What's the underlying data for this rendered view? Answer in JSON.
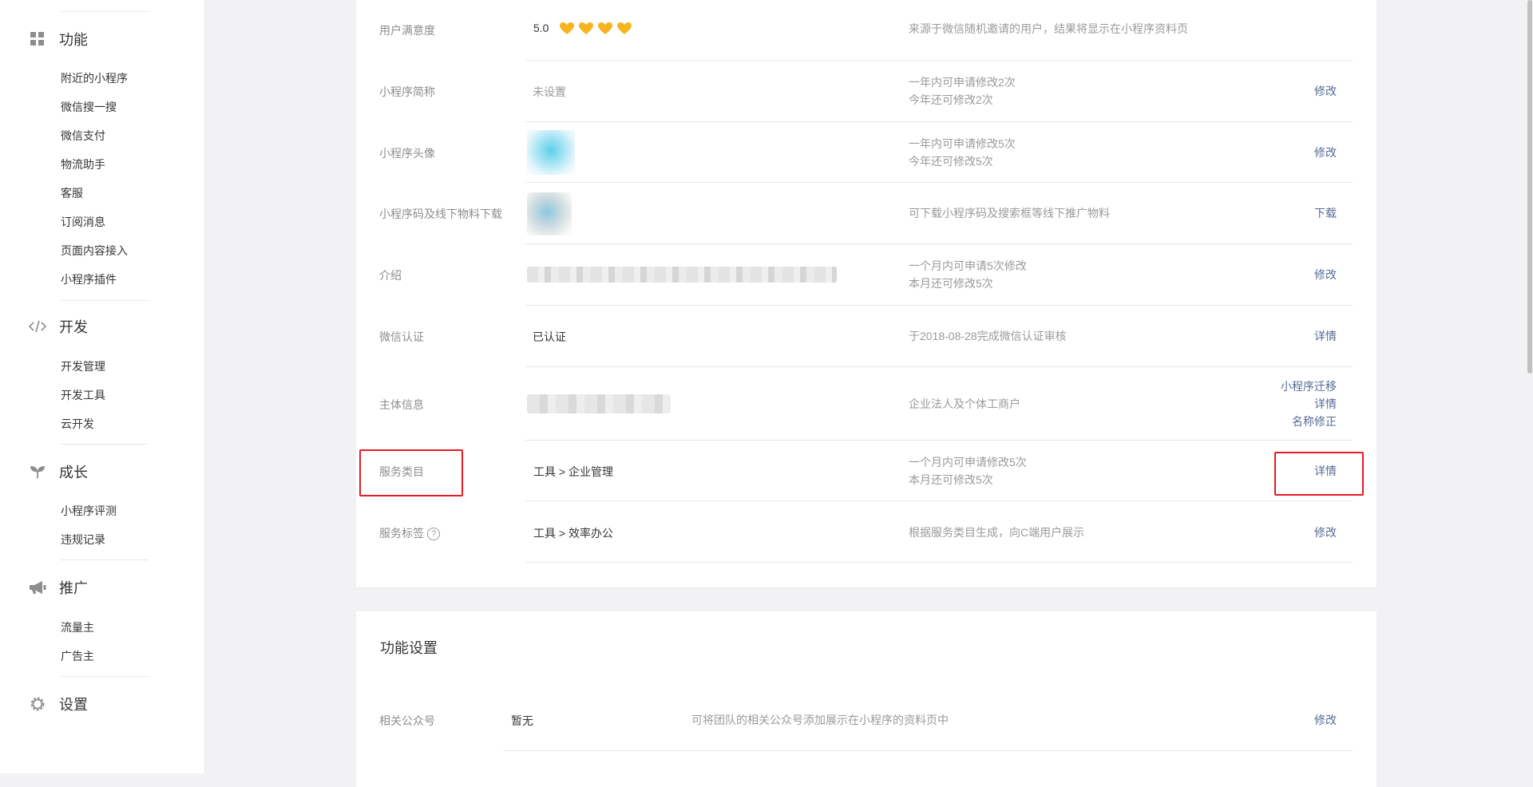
{
  "sidebar": {
    "sections": [
      {
        "title": "功能",
        "icon": "grid-icon",
        "items": [
          "附近的小程序",
          "微信搜一搜",
          "微信支付",
          "物流助手",
          "客服",
          "订阅消息",
          "页面内容接入",
          "小程序插件"
        ]
      },
      {
        "title": "开发",
        "icon": "code-icon",
        "items": [
          "开发管理",
          "开发工具",
          "云开发"
        ]
      },
      {
        "title": "成长",
        "icon": "sprout-icon",
        "items": [
          "小程序评测",
          "违规记录"
        ]
      },
      {
        "title": "推广",
        "icon": "megaphone-icon",
        "items": [
          "流量主",
          "广告主"
        ]
      },
      {
        "title": "设置",
        "icon": "gear-icon",
        "items": []
      }
    ]
  },
  "info": {
    "rows": [
      {
        "label": "用户满意度",
        "value": "5.0",
        "rating": 5.0,
        "hearts": 4,
        "note": "来源于微信随机邀请的用户，结果将显示在小程序资料页",
        "actions": []
      },
      {
        "label": "小程序简称",
        "value": "未设置",
        "note_lines": [
          "一年内可申请修改2次",
          "今年还可修改2次"
        ],
        "actions": [
          "修改"
        ]
      },
      {
        "label": "小程序头像",
        "note_lines": [
          "一年内可申请修改5次",
          "今年还可修改5次"
        ],
        "actions": [
          "修改"
        ]
      },
      {
        "label": "小程序码及线下物料下载",
        "note": "可下载小程序码及搜索框等线下推广物料",
        "actions": [
          "下载"
        ]
      },
      {
        "label": "介绍",
        "note_lines": [
          "一个月内可申请5次修改",
          "本月还可修改5次"
        ],
        "actions": [
          "修改"
        ]
      },
      {
        "label": "微信认证",
        "value": "已认证",
        "note": "于2018-08-28完成微信认证审核",
        "actions": [
          "详情"
        ]
      },
      {
        "label": "主体信息",
        "note": "企业法人及个体工商户",
        "actions": [
          "小程序迁移",
          "详情",
          "名称修正"
        ]
      },
      {
        "label": "服务类目",
        "value": "工具 > 企业管理",
        "note_lines": [
          "一个月内可申请修改5次",
          "本月还可修改5次"
        ],
        "actions": [
          "详情"
        ]
      },
      {
        "label": "服务标签",
        "value": "工具 > 效率办公",
        "note": "根据服务类目生成，向C端用户展示",
        "actions": [
          "修改"
        ]
      }
    ]
  },
  "feature_settings": {
    "title": "功能设置",
    "rows": [
      {
        "label": "相关公众号",
        "value": "暂无",
        "note": "可将团队的相关公众号添加展示在小程序的资料页中",
        "actions": [
          "修改"
        ]
      }
    ]
  },
  "colors": {
    "link": "#576b95",
    "heart": "#f6b51e",
    "highlight": "#e51c23"
  }
}
